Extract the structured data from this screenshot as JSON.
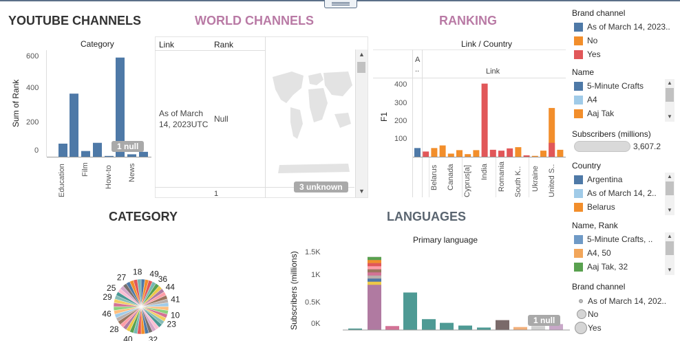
{
  "titles": {
    "youtube": "YOUTUBE CHANNELS",
    "world": "WORLD CHANNELS",
    "ranking": "RANKING",
    "category": "CATEGORY",
    "languages": "LANGUAGES"
  },
  "colors": {
    "blue": "#4e79a7",
    "orange": "#f28e2b",
    "red": "#e15759",
    "mauve": "#b07aa1",
    "teal": "#4e9a94",
    "title_pink": "#b97aa5",
    "title_dark": "#333333",
    "title_slate": "#5a6570"
  },
  "youtube_chart": {
    "subtitle": "Category",
    "ylabel": "Sum of Rank",
    "null_badge": "1 null",
    "xlabels": [
      "Education",
      "Film",
      "How-to",
      "News"
    ],
    "yticks": [
      "600",
      "400",
      "200",
      "0"
    ]
  },
  "world": {
    "col_link": "Link",
    "col_rank": "Rank",
    "row_link": "As of March 14, 2023UTC",
    "row_rank": "Null",
    "footer": "1",
    "unknown_badge": "3 unknown"
  },
  "ranking": {
    "subtitle": "Link / Country",
    "ylabel": "F1",
    "col_header_a": "A ..",
    "link_header": "Link",
    "yticks": [
      "400",
      "300",
      "200",
      "100"
    ],
    "xlabels": [
      "Belarus",
      "Canada",
      "Cyprus[a]",
      "India",
      "Romania",
      "South K..",
      "Ukraine",
      "United S.."
    ]
  },
  "category_pie": {
    "labels": [
      "18",
      "49",
      "36",
      "44",
      "41",
      "10",
      "23",
      "32",
      "40",
      "28",
      "46",
      "29",
      "25",
      "27"
    ]
  },
  "languages": {
    "subtitle": "Primary language",
    "ylabel": "Subscribers (millions)",
    "yticks": [
      "1.5K",
      "1K",
      "0.5K",
      "0K"
    ],
    "null_badge": "1 null"
  },
  "legend": {
    "brand_title": "Brand channel",
    "brand_items": [
      "As of March 14, 2023..",
      "No",
      "Yes"
    ],
    "name_title": "Name",
    "name_items": [
      "5-Minute Crafts",
      "A4",
      "Aaj Tak"
    ],
    "subs_title": "Subscribers (millions)",
    "subs_value": "3,607.2",
    "country_title": "Country",
    "country_items": [
      "Argentina",
      "As of March 14, 2..",
      "Belarus"
    ],
    "namerank_title": "Name, Rank",
    "namerank_items": [
      "5-Minute Crafts, ..",
      "A4, 50",
      "Aaj Tak, 32"
    ],
    "brand2_title": "Brand channel",
    "brand2_items": [
      "As of March 14, 202..",
      "No",
      "Yes"
    ]
  },
  "chart_data": [
    {
      "type": "bar",
      "title": "Category",
      "ylabel": "Sum of Rank",
      "ylim": [
        0,
        650
      ],
      "values": [
        80,
        385,
        35,
        85,
        5,
        605,
        15,
        30
      ]
    },
    {
      "type": "bar",
      "title": "Link / Country",
      "ylabel": "F1",
      "ylim": [
        0,
        450
      ],
      "series_colors": [
        "#4e79a7",
        "#e15759",
        "#f28e2b"
      ],
      "bars": [
        {
          "v": 50,
          "c": 0
        },
        {
          "v": 30,
          "c": 1
        },
        {
          "v": 50,
          "c": 2
        },
        {
          "v": 65,
          "c": 2
        },
        {
          "v": 18,
          "c": 2
        },
        {
          "v": 38,
          "c": 2
        },
        {
          "v": 15,
          "c": 2
        },
        {
          "v": 38,
          "c": 2
        },
        {
          "v": 420,
          "c": 1
        },
        {
          "v": 40,
          "c": 1
        },
        {
          "v": 35,
          "c": 1
        },
        {
          "v": 48,
          "c": 1
        },
        {
          "v": 55,
          "c": 2
        },
        {
          "v": 8,
          "c": 1
        },
        {
          "v": 5,
          "c": 2
        },
        {
          "v": 35,
          "c": 2
        },
        {
          "v": 280,
          "c": 2
        },
        {
          "v": 40,
          "c": 2
        }
      ]
    },
    {
      "type": "bar",
      "title": "Primary language",
      "ylabel": "Subscribers (millions)",
      "ylim": [
        0,
        1700
      ],
      "values": [
        30,
        1480,
        80,
        760,
        220,
        145,
        90,
        50,
        200,
        60,
        80,
        120
      ],
      "colors": [
        "#4e9a94",
        "#b07aa1",
        "#d37295",
        "#4e9a94",
        "#4e9a94",
        "#4e9a94",
        "#4e9a94",
        "#4e9a94",
        "#7a6a6a",
        "#f2b07a",
        "#d0d0d0",
        "#c8a8c8"
      ]
    }
  ]
}
